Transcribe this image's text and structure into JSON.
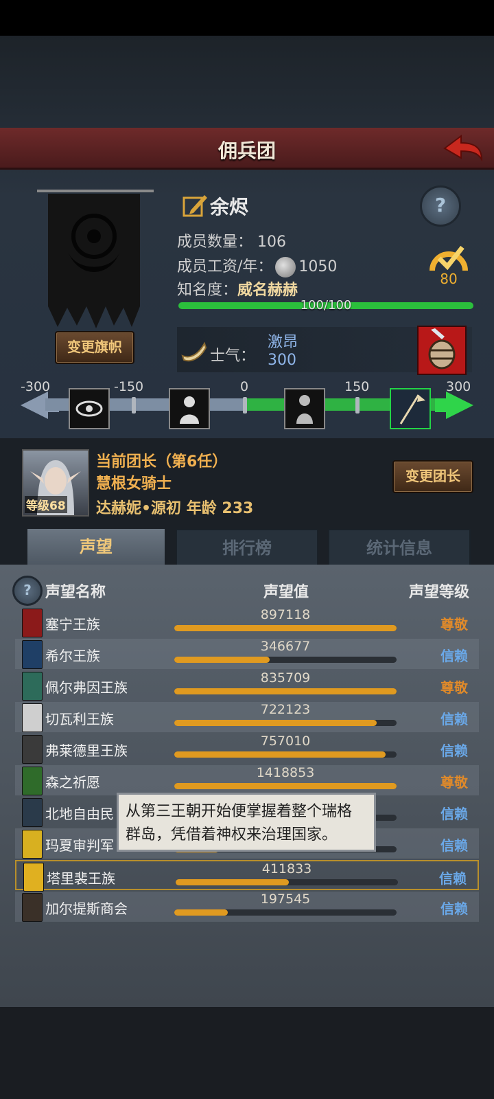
{
  "header": {
    "title": "佣兵团"
  },
  "guild": {
    "name": "余烬",
    "members_label": "成员数量：",
    "members_value": "106",
    "salary_label": "成员工资/年：",
    "salary_value": "1050",
    "fame_label": "知名度：",
    "fame_value": "威名赫赫",
    "fame_progress_text": "100/100",
    "fame_progress": 1.0,
    "gauge_value": "80",
    "change_banner_label": "变更旗帜",
    "help_glyph": "?"
  },
  "morale": {
    "label": "士气：",
    "state": "激昂",
    "value": "300",
    "scale_labels": [
      "-300",
      "-150",
      "0",
      "150",
      "300"
    ],
    "current_fraction": 1.0
  },
  "leader": {
    "title": "当前团长（第6任）",
    "class": "慧根女骑士",
    "name_age": "达赫妮•源初  年龄 233",
    "level": "等级68",
    "change_leader_label": "变更团长"
  },
  "tabs": [
    "声望",
    "排行榜",
    "统计信息"
  ],
  "reputation_table": {
    "columns": [
      "声望名称",
      "声望值",
      "声望等级"
    ],
    "rows": [
      {
        "name": "塞宁王族",
        "value": "897118",
        "fill": 1.0,
        "level": "尊敬",
        "level_color": "#e08a2a",
        "icon_color": "#8b1a1a"
      },
      {
        "name": "希尔王族",
        "value": "346677",
        "fill": 0.43,
        "level": "信赖",
        "level_color": "#6aa8e8",
        "icon_color": "#1f3f66"
      },
      {
        "name": "佩尔弗因王族",
        "value": "835709",
        "fill": 1.0,
        "level": "尊敬",
        "level_color": "#e08a2a",
        "icon_color": "#2d6b5a"
      },
      {
        "name": "切瓦利王族",
        "value": "722123",
        "fill": 0.91,
        "level": "信赖",
        "level_color": "#6aa8e8",
        "icon_color": "#cfcfcf"
      },
      {
        "name": "弗莱德里王族",
        "value": "757010",
        "fill": 0.95,
        "level": "信赖",
        "level_color": "#6aa8e8",
        "icon_color": "#3a3a3a"
      },
      {
        "name": "森之祈愿",
        "value": "1418853",
        "fill": 1.0,
        "level": "尊敬",
        "level_color": "#e08a2a",
        "icon_color": "#2f6b2a"
      },
      {
        "name": "北地自由民",
        "value": "",
        "fill": 0.0,
        "level": "信赖",
        "level_color": "#6aa8e8",
        "icon_color": "#2a3a4a"
      },
      {
        "name": "玛夏审判军",
        "value": "",
        "fill": 0.2,
        "level": "信赖",
        "level_color": "#6aa8e8",
        "icon_color": "#d8b020"
      },
      {
        "name": "塔里裴王族",
        "value": "411833",
        "fill": 0.51,
        "level": "信赖",
        "level_color": "#6aa8e8",
        "icon_color": "#e0b020"
      },
      {
        "name": "加尔提斯商会",
        "value": "197545",
        "fill": 0.24,
        "level": "信赖",
        "level_color": "#6aa8e8",
        "icon_color": "#3a3028"
      }
    ]
  },
  "tooltip": {
    "line1": "从第三王朝开始便掌握着整个瑞格",
    "line2": "群岛，凭借着神权来治理国家。"
  }
}
